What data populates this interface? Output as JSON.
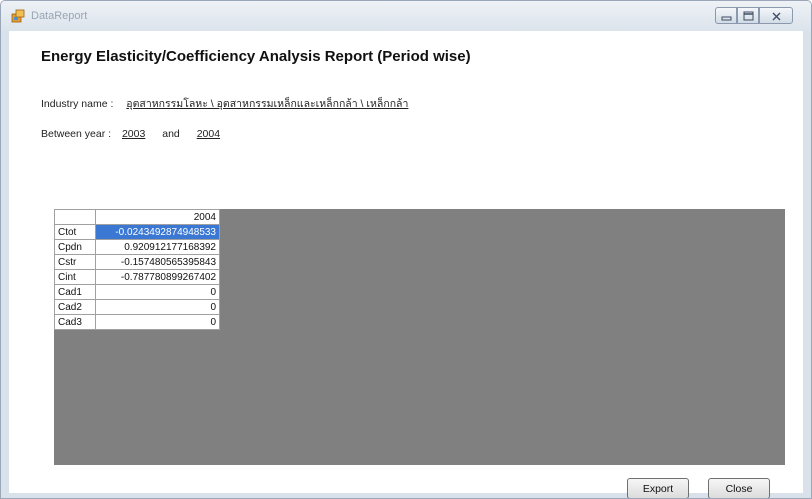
{
  "window": {
    "title": "DataReport",
    "controls": {
      "minimize": "minimize-icon",
      "maximize": "maximize-icon",
      "close": "close-icon"
    }
  },
  "report": {
    "heading": "Energy Elasticity/Coefficiency Analysis Report (Period wise)",
    "industry_label": "Industry name :",
    "industry_value": "อุตสาหกรรมโลหะ \\ อุตสาหกรรมเหล็กและเหล็กกล้า \\ เหล็กกล้า",
    "year_label": "Between year :",
    "year_from": "2003",
    "year_and": "and",
    "year_to": "2004"
  },
  "grid": {
    "columns": [
      "2004"
    ],
    "rows": [
      {
        "name": "Ctot",
        "value": "-0.0243492874948533",
        "selected": true
      },
      {
        "name": "Cpdn",
        "value": "0.920912177168392"
      },
      {
        "name": "Cstr",
        "value": "-0.157480565395843"
      },
      {
        "name": "Cint",
        "value": "-0.787780899267402"
      },
      {
        "name": "Cad1",
        "value": "0"
      },
      {
        "name": "Cad2",
        "value": "0"
      },
      {
        "name": "Cad3",
        "value": "0"
      }
    ]
  },
  "buttons": {
    "export": "Export",
    "close": "Close"
  },
  "colors": {
    "grid_background": "#808080",
    "selection": "#3a78d4",
    "title_text": "#9aa5b3"
  }
}
